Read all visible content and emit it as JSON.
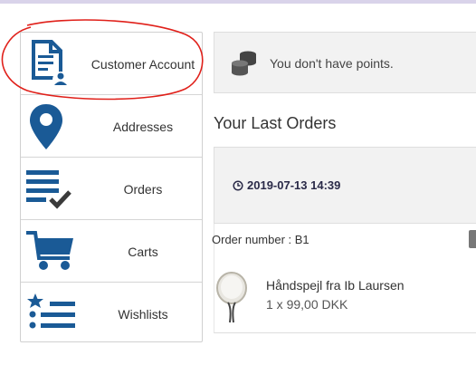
{
  "sidebar": {
    "items": [
      {
        "label": "Customer Account",
        "icon": "customer-account-icon"
      },
      {
        "label": "Addresses",
        "icon": "map-pin-icon"
      },
      {
        "label": "Orders",
        "icon": "orders-list-icon"
      },
      {
        "label": "Carts",
        "icon": "cart-icon"
      },
      {
        "label": "Wishlists",
        "icon": "wishlist-icon"
      }
    ]
  },
  "points": {
    "text": "You don't have points.",
    "icon": "coins-icon"
  },
  "last_orders": {
    "title": "Your Last Orders",
    "order": {
      "date": "2019-07-13 14:39",
      "number_text": "Order number : B1",
      "items": [
        {
          "name": "Håndspejl fra Ib Laursen",
          "qty_price": "1 x 99,00 DKK"
        }
      ]
    }
  },
  "colors": {
    "icon_blue": "#1a5a96",
    "annotation_red": "#e0201a",
    "top_bar": "#d9d3ea"
  }
}
